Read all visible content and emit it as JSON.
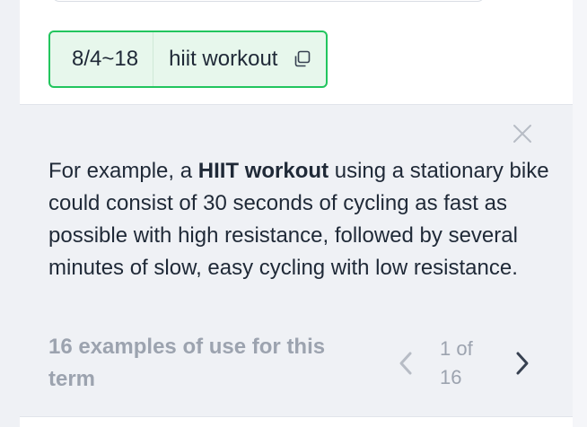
{
  "term_chip": {
    "code": "8/4~18",
    "term": "hiit workout",
    "copy_icon": "copy-icon"
  },
  "example": {
    "before": "For example, a ",
    "highlight": "HIIT workout",
    "after": " using a stationary bike could consist of 30 seconds of cycling as fast as possible with high resistance, followed by several minutes of slow, easy cycling with low resistance.",
    "close_icon": "close-icon"
  },
  "footer": {
    "examples_count": "16 examples of use for this term",
    "pager_label": "1 of 16",
    "prev_icon": "chevron-left-icon",
    "next_icon": "chevron-right-icon"
  },
  "colors": {
    "accent_green": "#22c55e",
    "chip_bg": "#e7f7ec",
    "panel_bg": "#eff1f5",
    "muted_text": "#9ca3af"
  }
}
